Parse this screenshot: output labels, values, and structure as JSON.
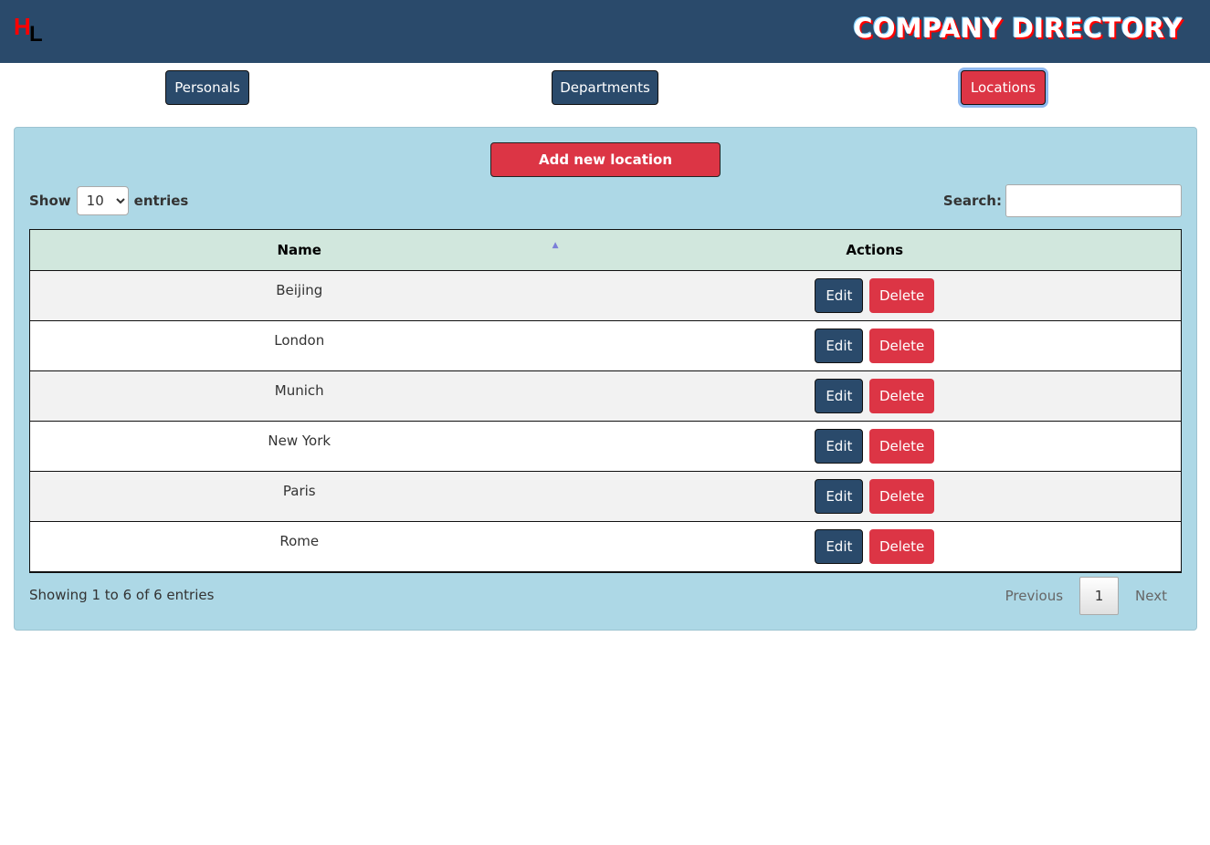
{
  "header": {
    "logo_first": "H",
    "logo_second": "L",
    "title": "COMPANY DIRECTORY"
  },
  "nav": {
    "items": [
      {
        "label": "Personals",
        "active": false
      },
      {
        "label": "Departments",
        "active": false
      },
      {
        "label": "Locations",
        "active": true
      }
    ]
  },
  "panel": {
    "add_button_label": "Add new location",
    "show_label": "Show",
    "entries_label": "entries",
    "page_length_selected": "10",
    "search_label": "Search:",
    "search_value": "",
    "search_placeholder": ""
  },
  "table": {
    "columns": [
      "Name",
      "Actions"
    ],
    "sort_indicator": "▲",
    "rows": [
      {
        "name": "Beijing",
        "edit_label": "Edit",
        "delete_label": "Delete"
      },
      {
        "name": "London",
        "edit_label": "Edit",
        "delete_label": "Delete"
      },
      {
        "name": "Munich",
        "edit_label": "Edit",
        "delete_label": "Delete"
      },
      {
        "name": "New York",
        "edit_label": "Edit",
        "delete_label": "Delete"
      },
      {
        "name": "Paris",
        "edit_label": "Edit",
        "delete_label": "Delete"
      },
      {
        "name": "Rome",
        "edit_label": "Edit",
        "delete_label": "Delete"
      }
    ]
  },
  "footer": {
    "info": "Showing 1 to 6 of 6 entries",
    "previous_label": "Previous",
    "current_page": "1",
    "next_label": "Next"
  },
  "colors": {
    "header_bg": "#2a4a6b",
    "accent_red": "#dc3545",
    "panel_bg": "#add8e6",
    "table_header_bg": "#d1e7dd"
  }
}
